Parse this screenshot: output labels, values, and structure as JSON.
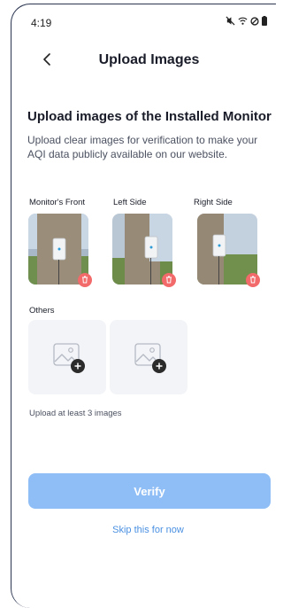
{
  "status_bar": {
    "time": "4:19",
    "icons": [
      "mute-icon",
      "wifi-icon",
      "dnd-icon",
      "battery-icon"
    ]
  },
  "nav": {
    "title": "Upload Images",
    "back_icon": "chevron-left-icon"
  },
  "section": {
    "title": "Upload images of the Installed Monitor",
    "description": "Upload clear images for verification to make your AQI data publicly available on our website."
  },
  "images": [
    {
      "label": "Monitor's Front",
      "delete_icon": "trash-icon"
    },
    {
      "label": "Left Side",
      "delete_icon": "trash-icon"
    },
    {
      "label": "Right Side",
      "delete_icon": "trash-icon"
    }
  ],
  "others": {
    "label": "Others",
    "tiles": [
      {
        "icon": "image-placeholder-icon",
        "action_icon": "plus-icon"
      },
      {
        "icon": "image-placeholder-icon",
        "action_icon": "plus-icon"
      }
    ]
  },
  "hint": "Upload at least 3 images",
  "actions": {
    "verify_label": "Verify",
    "skip_label": "Skip this for now"
  },
  "colors": {
    "primary": "#8fbdf5",
    "link": "#4a90e2",
    "delete": "#f26a6a",
    "tile_bg": "#f3f4f8"
  }
}
